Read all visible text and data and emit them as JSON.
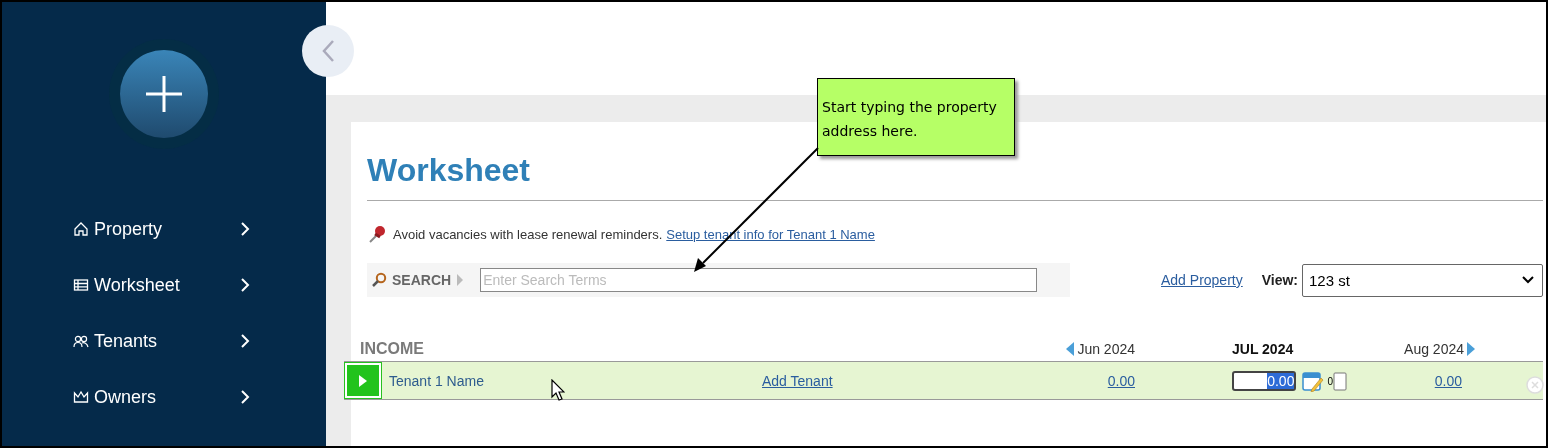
{
  "sidebar": {
    "items": [
      {
        "label": "Property",
        "kind": "home"
      },
      {
        "label": "Worksheet",
        "kind": "sheet"
      },
      {
        "label": "Tenants",
        "kind": "people"
      },
      {
        "label": "Owners",
        "kind": "crown"
      }
    ]
  },
  "callout": {
    "text": "Start typing the property address here."
  },
  "worksheet": {
    "title": "Worksheet",
    "tip": {
      "text": "Avoid vacancies with lease renewal reminders.",
      "link": "Setup tenant info for Tenant 1 Name"
    },
    "search": {
      "label": "SEARCH",
      "placeholder": "Enter Search Terms"
    },
    "add_property": "Add Property",
    "view": {
      "label": "View:",
      "value": "123 st"
    }
  },
  "income": {
    "title": "INCOME",
    "months": [
      {
        "label": "Jun 2024",
        "current": false
      },
      {
        "label": "JUL 2024",
        "current": true
      },
      {
        "label": "Aug 2024",
        "current": false
      }
    ],
    "rows": [
      {
        "name": "Tenant 1 Name",
        "action": "Add Tenant",
        "expanded": false,
        "jun": "0.00",
        "jul": "0.00",
        "attachments": "0",
        "aug": "0.00"
      }
    ]
  }
}
